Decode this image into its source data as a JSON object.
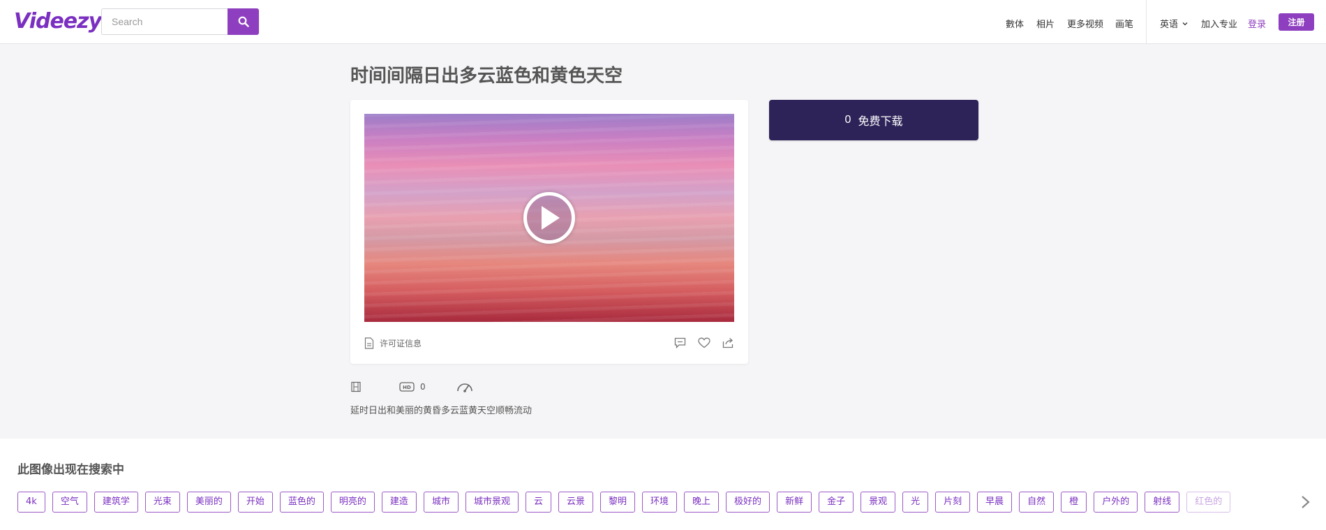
{
  "header": {
    "logo": "Videezy",
    "search_placeholder": "Search",
    "nav": {
      "media": "數体",
      "photos": "相片",
      "more_videos": "更多视频",
      "brush": "画笔",
      "language": "英语",
      "join_pro": "加入专业",
      "login": "登录",
      "signup": "注册"
    }
  },
  "page": {
    "title": "时间间隔日出多云蓝色和黄色天空",
    "license_label": "许可证信息",
    "download_count": "0",
    "download_label": "免费下载",
    "hd_count": "0",
    "description": "延时日出和美丽的黄昏多云蓝黄天空顺畅流动"
  },
  "tags_section": {
    "heading": "此图像出现在搜索中",
    "tags": [
      "4k",
      "空气",
      "建筑学",
      "光束",
      "美丽的",
      "开始",
      "蓝色的",
      "明亮的",
      "建造",
      "城市",
      "城市景观",
      "云",
      "云景",
      "黎明",
      "环境",
      "晚上",
      "极好的",
      "新鲜",
      "金子",
      "景观",
      "光",
      "片刻",
      "早晨",
      "自然",
      "橙",
      "户外的",
      "射线",
      "红色的"
    ]
  },
  "colors": {
    "accent": "#8e3fbf",
    "download_bg": "#2e2358",
    "page_bg": "#f5f4f6"
  }
}
